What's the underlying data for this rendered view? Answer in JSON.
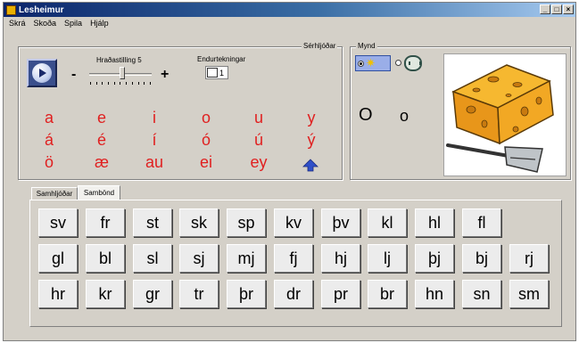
{
  "window": {
    "title": "Lesheimur",
    "title_buttons": [
      "_",
      "□",
      "×"
    ]
  },
  "menu": [
    "Skrá",
    "Skoða",
    "Spila",
    "Hjálp"
  ],
  "speed": {
    "label": "Hraðastilling 5",
    "minus": "-",
    "plus": "+",
    "level": 5
  },
  "repeat": {
    "label": "Endurtekningar",
    "value": "1"
  },
  "vowels_group": {
    "label": "Sérhljóðar",
    "rows": [
      [
        "a",
        "e",
        "i",
        "o",
        "u",
        "y"
      ],
      [
        "á",
        "é",
        "í",
        "ó",
        "ú",
        "ý"
      ],
      [
        "ö",
        "æ",
        "au",
        "ei",
        "ey"
      ]
    ],
    "letter_color": "#e02020"
  },
  "picture_group": {
    "label": "Mynd",
    "selected_option": "sun-icon",
    "display_upper": "O",
    "display_lower": "o",
    "image": "cheese-with-slicer"
  },
  "tabs": [
    "Samhljóðar",
    "Sambönd"
  ],
  "active_tab": "Sambönd",
  "combinations": [
    [
      "sv",
      "fr",
      "st",
      "sk",
      "sp",
      "kv",
      "þv",
      "kl",
      "hl",
      "fl"
    ],
    [
      "gl",
      "bl",
      "sl",
      "sj",
      "mj",
      "fj",
      "hj",
      "lj",
      "þj",
      "bj",
      "rj"
    ],
    [
      "hr",
      "kr",
      "gr",
      "tr",
      "þr",
      "dr",
      "pr",
      "br",
      "hn",
      "sn",
      "sm"
    ]
  ]
}
